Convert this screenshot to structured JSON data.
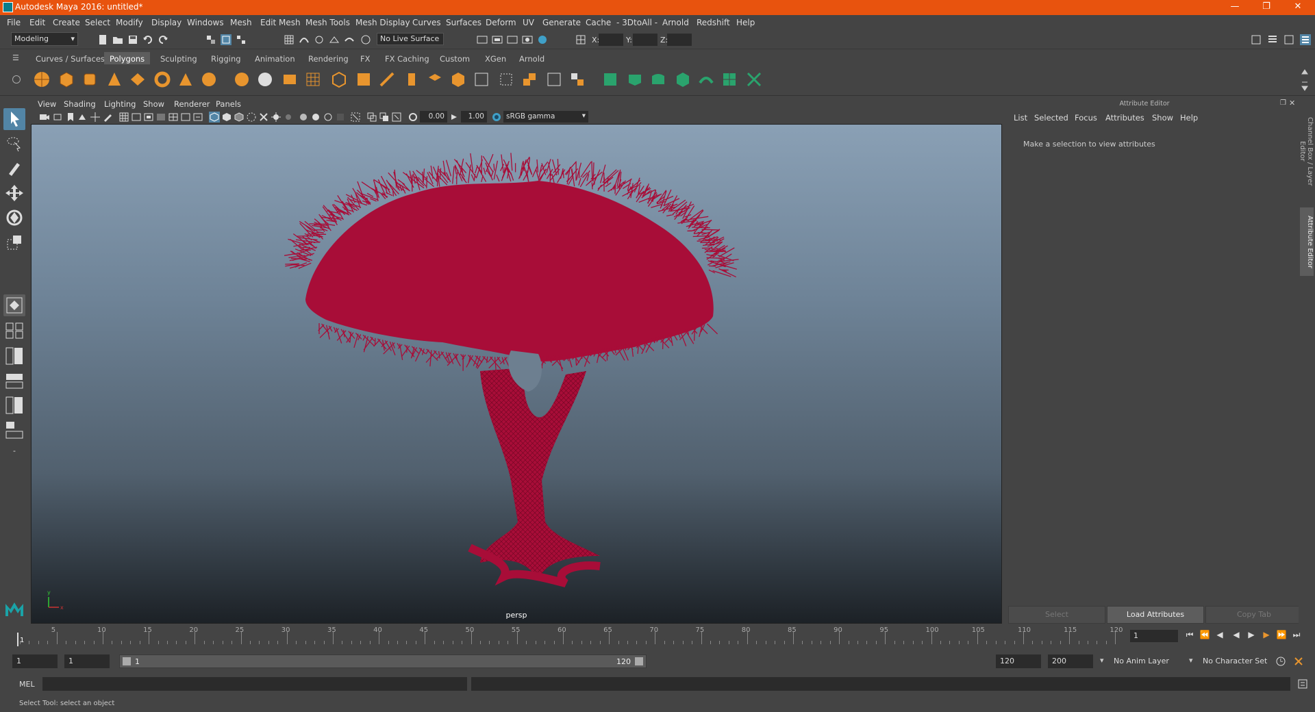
{
  "window": {
    "title": "Autodesk Maya 2016: untitled*"
  },
  "menubar": [
    "File",
    "Edit",
    "Create",
    "Select",
    "Modify",
    "Display",
    "Windows",
    "Mesh",
    "Edit Mesh",
    "Mesh Tools",
    "Mesh Display",
    "Curves",
    "Surfaces",
    "Deform",
    "UV",
    "Generate",
    "Cache",
    "- 3DtoAll -",
    "Arnold",
    "Redshift",
    "Help"
  ],
  "status": {
    "mode": "Modeling",
    "live_surface": "No Live Surface",
    "x_label": "X:",
    "y_label": "Y:",
    "z_label": "Z:"
  },
  "shelf": {
    "tabs": [
      "Curves / Surfaces",
      "Polygons",
      "Sculpting",
      "Rigging",
      "Animation",
      "Rendering",
      "FX",
      "FX Caching",
      "Custom",
      "XGen",
      "Arnold"
    ],
    "active_tab": "Polygons"
  },
  "viewport": {
    "menu": [
      "View",
      "Shading",
      "Lighting",
      "Show",
      "Renderer",
      "Panels"
    ],
    "exposure": "0.00",
    "gamma": "1.00",
    "color_space": "sRGB gamma",
    "camera": "persp",
    "mesh_color": "#a80d38",
    "axis_y": "y",
    "axis_x": "x"
  },
  "attribute_editor": {
    "title": "Attribute Editor",
    "menu": [
      "List",
      "Selected",
      "Focus",
      "Attributes",
      "Show",
      "Help"
    ],
    "message": "Make a selection to view attributes",
    "buttons": [
      "Select",
      "Load Attributes",
      "Copy Tab"
    ],
    "side_tabs": [
      "Channel Box / Layer Editor",
      "Attribute Editor"
    ]
  },
  "timeline": {
    "ticks": [
      "5",
      "10",
      "15",
      "20",
      "25",
      "30",
      "35",
      "40",
      "45",
      "50",
      "55",
      "60",
      "65",
      "70",
      "75",
      "80",
      "85",
      "90",
      "95",
      "100",
      "105",
      "110",
      "115",
      "120"
    ],
    "start_marker": "1",
    "current_frame": "1"
  },
  "range": {
    "start": "1",
    "playback_start": "1",
    "slider_start": "1",
    "slider_end": "120",
    "playback_end": "120",
    "end": "200",
    "anim_layer": "No Anim Layer",
    "character_set": "No Character Set"
  },
  "command": {
    "label": "MEL"
  },
  "help_line": "Select Tool: select an object",
  "colors": {
    "title_bar": "#e8530e",
    "accent_tab": "#5d5d5d"
  }
}
